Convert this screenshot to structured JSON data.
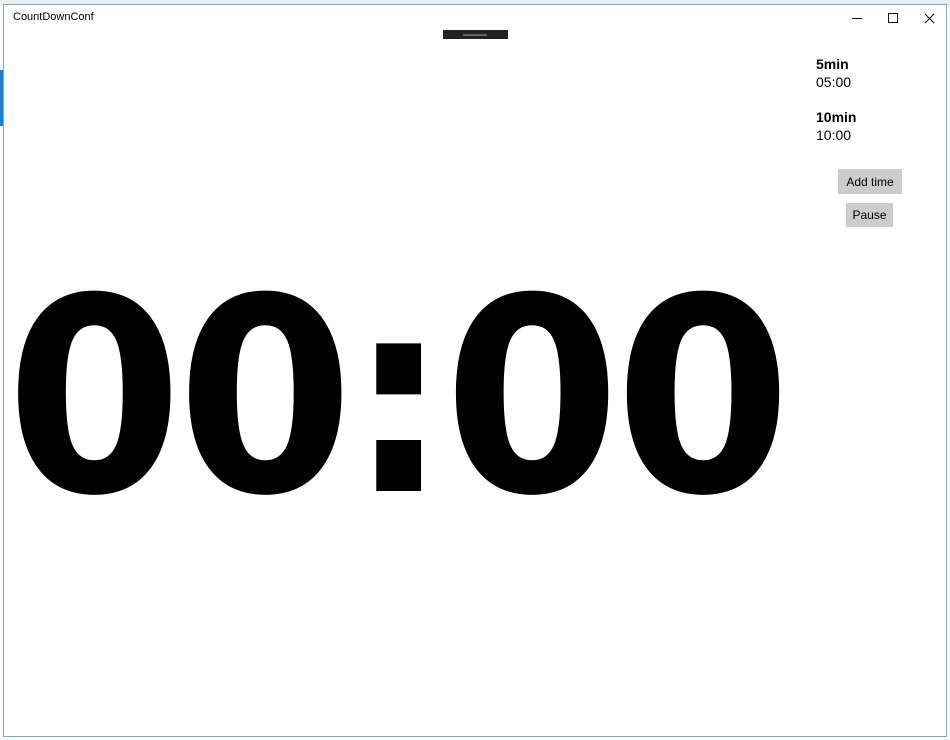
{
  "window": {
    "title": "CountDownConf"
  },
  "titlebar_controls": {
    "minimize_icon": "minimize-icon",
    "maximize_icon": "maximize-icon",
    "close_icon": "close-icon"
  },
  "presets": [
    {
      "name": "5min",
      "time": "05:00"
    },
    {
      "name": "10min",
      "time": "10:00"
    }
  ],
  "actions": {
    "add_time_label": "Add time",
    "pause_label": "Pause"
  },
  "timer": {
    "display": "00:00"
  },
  "colors": {
    "button_bg": "#cccccc",
    "text": "#000000",
    "window_border": "#7aa6cf"
  }
}
